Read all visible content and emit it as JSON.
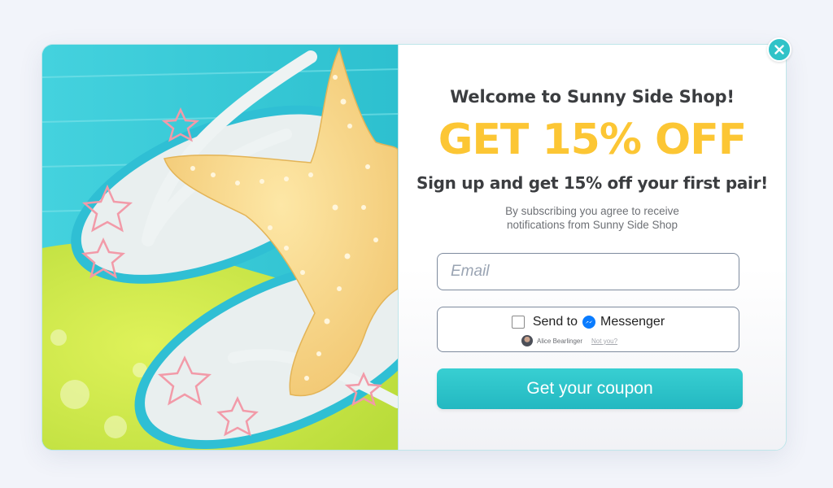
{
  "popup": {
    "welcome": "Welcome to Sunny Side Shop!",
    "headline": "GET 15% OFF",
    "subline": "Sign up and get 15% off your first pair!",
    "disclaimer": "By subscribing you agree to receive notifications from Sunny Side Shop",
    "email": {
      "placeholder": "Email",
      "value": ""
    },
    "messenger": {
      "send_to": "Send to",
      "brand": "Messenger",
      "checked": false,
      "user_name": "Alice Bearlinger",
      "not_you": "Not you?"
    },
    "cta_label": "Get your coupon",
    "close_icon": "close-icon"
  },
  "hero_image": {
    "description_icon": "beach-photo",
    "subject": "flip-flops and starfish"
  },
  "colors": {
    "accent_teal": "#2fbfc6",
    "headline_yellow": "#fcc634",
    "text_dark": "#3b3d40",
    "messenger_blue": "#0a7cff"
  }
}
